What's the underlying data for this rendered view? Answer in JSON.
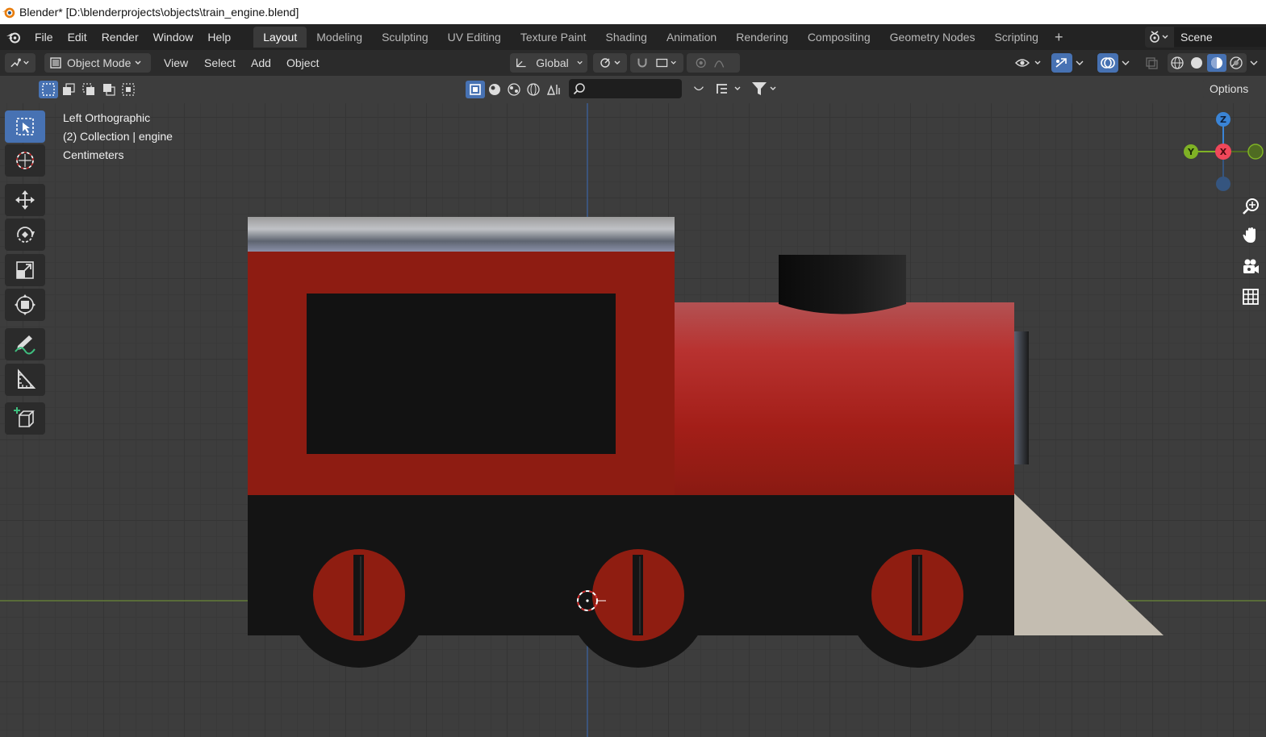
{
  "window": {
    "title": "Blender* [D:\\blenderprojects\\objects\\train_engine.blend]"
  },
  "menus": [
    "File",
    "Edit",
    "Render",
    "Window",
    "Help"
  ],
  "workspace_tabs": [
    {
      "label": "Layout",
      "active": true
    },
    {
      "label": "Modeling",
      "active": false
    },
    {
      "label": "Sculpting",
      "active": false
    },
    {
      "label": "UV Editing",
      "active": false
    },
    {
      "label": "Texture Paint",
      "active": false
    },
    {
      "label": "Shading",
      "active": false
    },
    {
      "label": "Animation",
      "active": false
    },
    {
      "label": "Rendering",
      "active": false
    },
    {
      "label": "Compositing",
      "active": false
    },
    {
      "label": "Geometry Nodes",
      "active": false
    },
    {
      "label": "Scripting",
      "active": false
    }
  ],
  "add_workspace_symbol": "+",
  "scene": {
    "name": "Scene"
  },
  "header": {
    "mode": "Object Mode",
    "view": "View",
    "select": "Select",
    "add": "Add",
    "object": "Object",
    "orientation": "Global"
  },
  "options_label": "Options",
  "viewport": {
    "view_name": "Left Orthographic",
    "collection": "(2) Collection | engine",
    "units": "Centimeters"
  },
  "gizmo": {
    "z_label": "Z",
    "y_label": "Y",
    "x_label": "X",
    "colors": {
      "x": "#f0475a",
      "y": "#7fb225",
      "z": "#3a84d6"
    }
  },
  "icons": {
    "toolbar": [
      "select-box-icon",
      "cursor-icon",
      "move-icon",
      "rotate-icon",
      "scale-icon",
      "transform-icon",
      "annotate-icon",
      "measure-icon",
      "add-cube-icon"
    ],
    "navigation": [
      "zoom-icon",
      "pan-hand-icon",
      "camera-icon",
      "grid-icon"
    ]
  },
  "colors": {
    "accent": "#4772b3",
    "engine_red": "#8e1c12",
    "engine_black": "#141414",
    "cowcatcher": "#c4bdb1"
  }
}
